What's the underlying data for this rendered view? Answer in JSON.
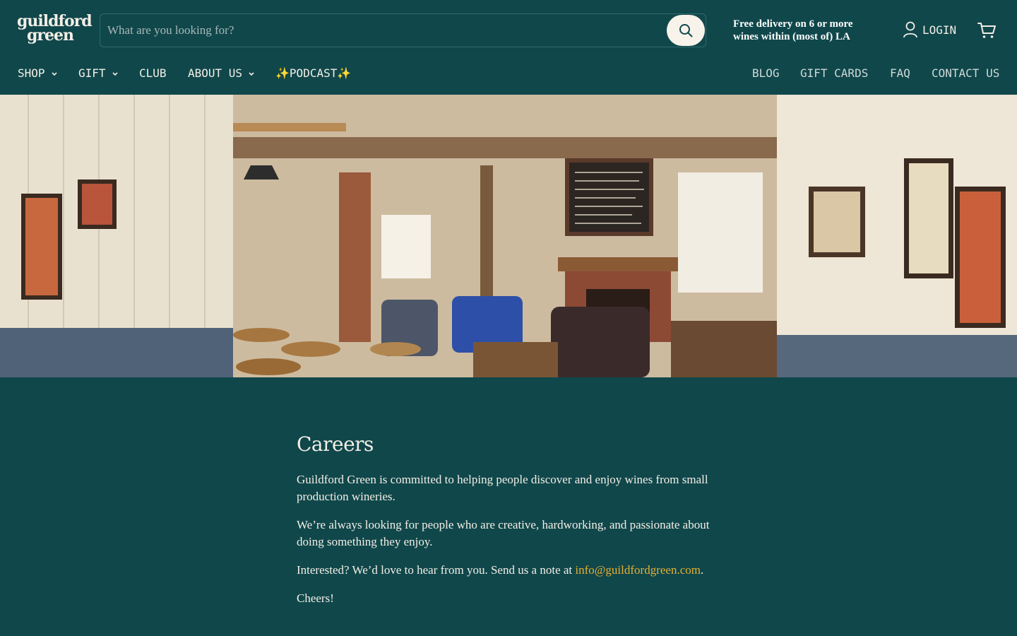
{
  "brand": {
    "logo_line1": "guildford",
    "logo_line2": "green"
  },
  "search": {
    "placeholder": "What are you looking for?"
  },
  "promo": {
    "line1": "Free delivery on 6 or more",
    "line2": "wines within (most of) LA"
  },
  "account": {
    "login_label": "LOGIN"
  },
  "nav": {
    "left": [
      {
        "label": "SHOP",
        "has_dropdown": true
      },
      {
        "label": "GIFT",
        "has_dropdown": true
      },
      {
        "label": "CLUB",
        "has_dropdown": false
      },
      {
        "label": "ABOUT US",
        "has_dropdown": true
      },
      {
        "label": "✨PODCAST✨",
        "has_dropdown": false
      }
    ],
    "right": [
      {
        "label": "BLOG"
      },
      {
        "label": "GIFT CARDS"
      },
      {
        "label": "FAQ"
      },
      {
        "label": "CONTACT US"
      }
    ]
  },
  "page": {
    "title": "Careers",
    "paragraph1": "Guildford Green is committed to helping people discover and enjoy wines from small production wineries.",
    "paragraph2": "We’re always looking for people who are creative, hardworking, and passionate about doing something they enjoy.",
    "paragraph3_prefix": "Interested? We’d love to hear from you. Send us a note at ",
    "email": "info@guildfordgreen.com",
    "paragraph3_suffix": ".",
    "signoff": "Cheers!"
  },
  "colors": {
    "background": "#10474b",
    "text": "#f3efe6",
    "link": "#e6b033",
    "search_button": "#f7f3ea"
  },
  "icons": [
    "search-icon",
    "user-icon",
    "cart-icon",
    "chevron-down-icon"
  ]
}
